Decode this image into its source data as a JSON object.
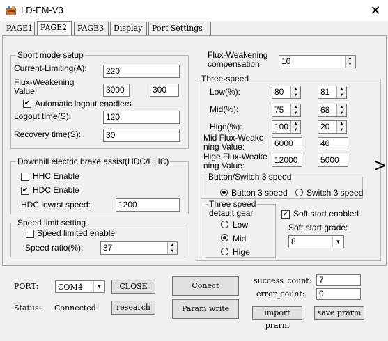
{
  "window": {
    "title": "LD-EM-V3",
    "close_glyph": "✕"
  },
  "tabs": [
    "PAGE1",
    "PAGE2",
    "PAGE3",
    "Display",
    "Port Settings"
  ],
  "sport_mode": {
    "label": "Sport mode setup",
    "current_limit_label": "Current-Limiting(A):",
    "current_limit": "220",
    "flux_label_1": "Flux-Weakening",
    "flux_label_2": "Value:",
    "flux_value_a": "3000",
    "flux_value_b": "300",
    "auto_logout_label": "Automatic logout enadlers",
    "auto_logout_checked": "✔",
    "logout_time_label": "Logout time(S):",
    "logout_time": "120",
    "recovery_time_label": "Recovery time(S):",
    "recovery_time": "30"
  },
  "downhill": {
    "label": "Downhill electric brake assist(HDC/HHC)",
    "hhc_label": "HHC Enable",
    "hhc_checked": "",
    "hdc_label": "HDC Enable",
    "hdc_checked": "✔",
    "lowest_speed_label": "HDC lowrst speed:",
    "lowest_speed": "1200"
  },
  "speed_limit": {
    "label": "Speed limit setting",
    "enable_label": "Speed limited enable",
    "enable_checked": "",
    "ratio_label": "Speed ratio(%):",
    "ratio": "37"
  },
  "flux_comp": {
    "label_1": "Flux-Weakening",
    "label_2": "compensation:",
    "value": "10"
  },
  "three_speed": {
    "label": "Three-speed",
    "low_label": "Low(%):",
    "low_a": "80",
    "low_b": "81",
    "mid_label": "Mid(%):",
    "mid_a": "75",
    "mid_b": "68",
    "high_label": "Hige(%):",
    "high_a": "100",
    "high_b": "20",
    "mid_flux_label_1": "Mid Flux-Weake",
    "mid_flux_label_2": "ning Value:",
    "mid_flux_a": "6000",
    "mid_flux_b": "40",
    "high_flux_label_1": "Hige Flux-Weake",
    "high_flux_label_2": "ning Value:",
    "high_flux_a": "12000",
    "high_flux_b": "5000"
  },
  "button_switch": {
    "label": "Button/Switch 3 speed",
    "button_label": "Button 3 speed",
    "switch_label": "Switch 3 speed"
  },
  "default_gear": {
    "label_1": "Three speed",
    "label_2": "detault gear",
    "low": "Low",
    "mid": "Mid",
    "high": "Hige"
  },
  "soft_start": {
    "enabled_label": "Soft start enabled",
    "enabled_checked": "✔",
    "grade_label": "Soft start grade:",
    "grade": "8"
  },
  "next_arrow": ">",
  "port": {
    "port_label": "PORT:",
    "port_value": "COM4",
    "close_label": "CLOSE",
    "status_label": "Status:",
    "status_value": "Connected",
    "research_label": "research"
  },
  "actions": {
    "connect_label": "Conect",
    "param_write_label": "Param write",
    "import_label": "import prarm",
    "save_label": "save prarm"
  },
  "counts": {
    "success_label": "success_count:",
    "success_value": "7",
    "error_label": "error_count:",
    "error_value": "0"
  }
}
